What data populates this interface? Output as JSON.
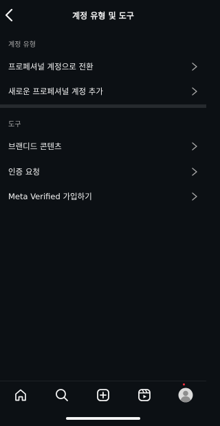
{
  "header": {
    "title": "계정 유형 및 도구"
  },
  "sections": [
    {
      "label": "계정 유형",
      "items": [
        {
          "label": "프로페셔널 계정으로 전환"
        },
        {
          "label": "새로운 프로페셔널 계정 추가"
        }
      ]
    },
    {
      "label": "도구",
      "items": [
        {
          "label": "브랜디드 콘텐츠"
        },
        {
          "label": "인증 요청"
        },
        {
          "label": "Meta Verified 가입하기"
        }
      ]
    }
  ],
  "tabbar": {
    "items": [
      {
        "icon": "home-icon"
      },
      {
        "icon": "search-icon"
      },
      {
        "icon": "create-post-icon"
      },
      {
        "icon": "reels-icon"
      },
      {
        "icon": "profile-avatar"
      }
    ],
    "profile_has_notification": true
  },
  "colors": {
    "background": "#0c1014",
    "text_primary": "#f5f5f5",
    "text_secondary": "#a8a8a8",
    "notification": "#ff3040"
  }
}
